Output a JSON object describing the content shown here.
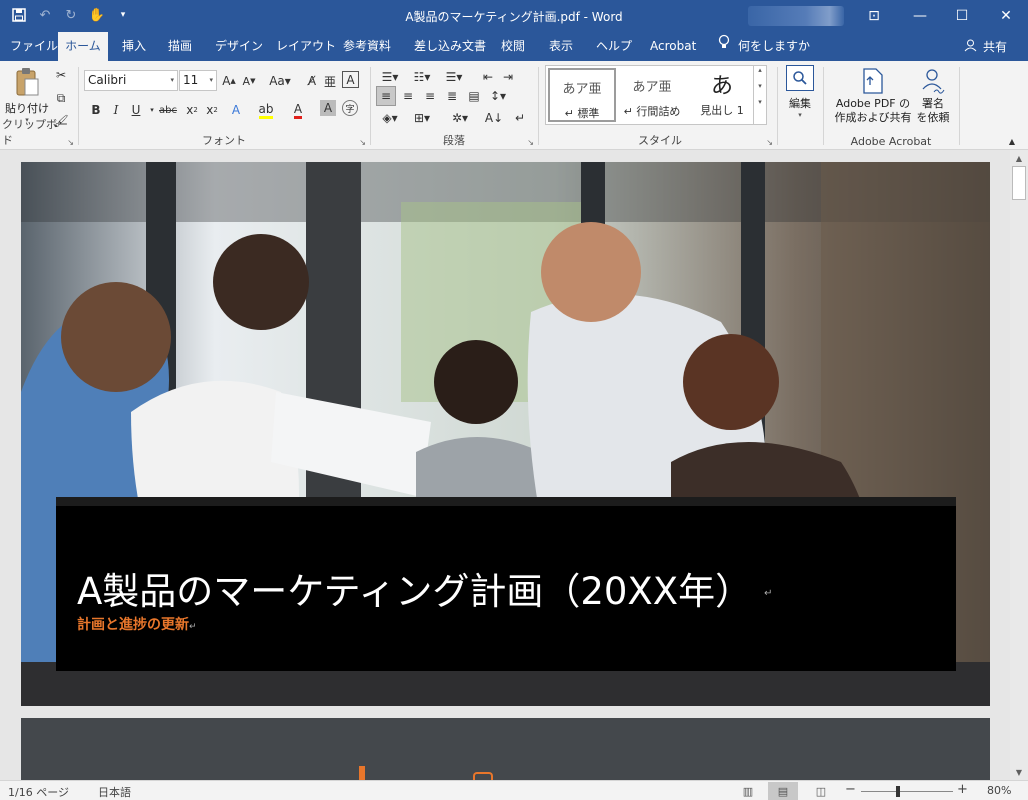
{
  "window": {
    "title": "A製品のマーケティング計画.pdf  -  Word",
    "controls": {
      "ribbon_display": "⊡",
      "minimize": "—",
      "maximize": "☐",
      "close": "✕"
    }
  },
  "qat": {
    "save_icon": "save-icon",
    "undo_icon": "undo-icon",
    "redo_icon": "redo-icon",
    "touch_icon": "touch-mode-icon",
    "customize_icon": "customize-icon"
  },
  "tabs": [
    {
      "label": "ファイル"
    },
    {
      "label": "ホーム",
      "active": true
    },
    {
      "label": "挿入"
    },
    {
      "label": "描画"
    },
    {
      "label": "デザイン"
    },
    {
      "label": "レイアウト"
    },
    {
      "label": "参考資料"
    },
    {
      "label": "差し込み文書"
    },
    {
      "label": "校閲"
    },
    {
      "label": "表示"
    },
    {
      "label": "ヘルプ"
    },
    {
      "label": "Acrobat"
    }
  ],
  "tell_me": "何をしますか",
  "share": "共有",
  "ribbon": {
    "clipboard": {
      "paste_label": "貼り付け",
      "group_label": "クリップボード"
    },
    "font": {
      "font_name": "Calibri",
      "font_size": "11",
      "group_label": "フォント"
    },
    "paragraph": {
      "group_label": "段落"
    },
    "styles": {
      "group_label": "スタイル",
      "items": [
        {
          "preview": "あア亜",
          "name": "↵ 標準"
        },
        {
          "preview": "あア亜",
          "name": "↵ 行間詰め"
        },
        {
          "preview": "あ",
          "name": "見出し 1"
        }
      ]
    },
    "editing": {
      "label": "編集"
    },
    "acrobat": {
      "group_label": "Adobe Acrobat",
      "create_pdf_line1": "Adobe PDF の",
      "create_pdf_line2": "作成および共有",
      "sign_line1": "署名",
      "sign_line2": "を依頼"
    }
  },
  "document": {
    "title": "A製品のマーケティング計画（20XX年）",
    "subtitle": "計画と進捗の更新",
    "paragraph_mark": "↵"
  },
  "statusbar": {
    "page": "1/16 ページ",
    "language": "日本語",
    "zoom": "80%",
    "zoom_minus": "−",
    "zoom_plus": "+"
  },
  "colors": {
    "brand": "#2b579a",
    "accent_orange": "#e8762b",
    "ribbon_bg": "#f3f3f3",
    "doc_bg": "#e6e6e6"
  }
}
